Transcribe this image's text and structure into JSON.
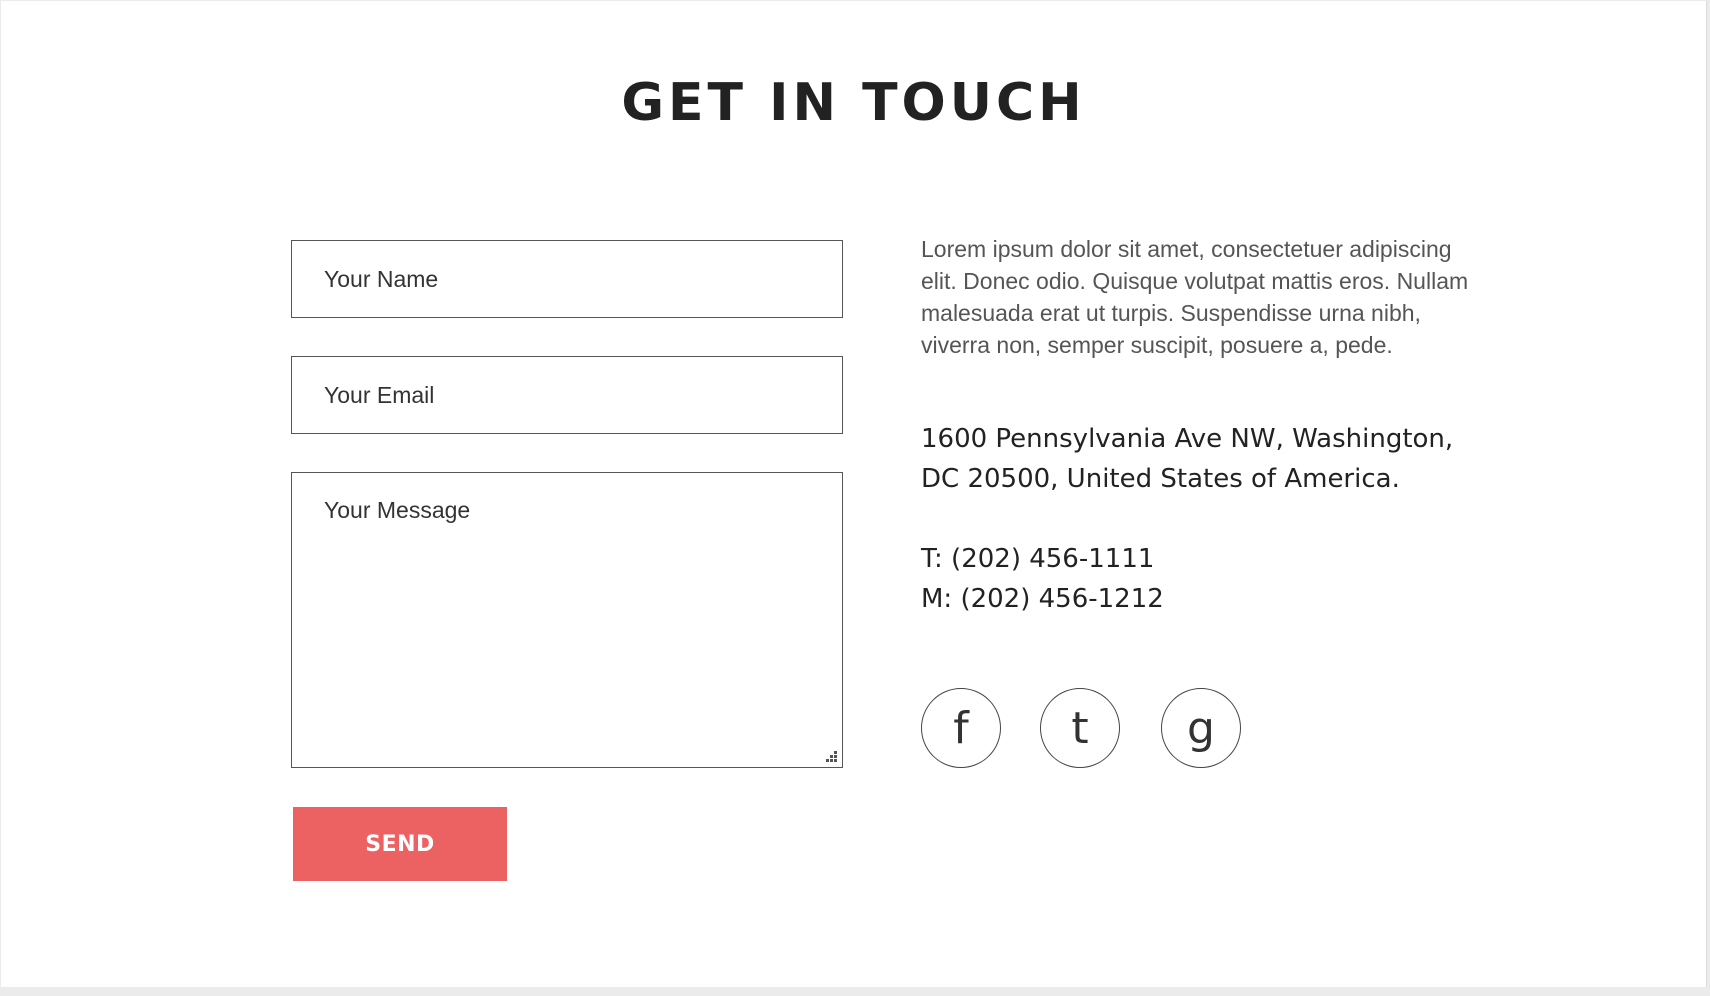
{
  "page": {
    "title": "GET IN TOUCH"
  },
  "form": {
    "name_placeholder": "Your Name",
    "email_placeholder": "Your Email",
    "message_placeholder": "Your Message",
    "send_label": "SEND"
  },
  "info": {
    "description": "Lorem ipsum dolor sit amet, consectetuer adipiscing elit. Donec odio. Quisque volutpat mattis eros. Nullam malesuada erat ut turpis. Suspendisse urna nibh, viverra non, semper suscipit, posuere a, pede.",
    "address_line1": "1600 Pennsylvania Ave NW, Washington,",
    "address_line2": "DC 20500, United States of America.",
    "phone": "T: (202) 456-1111",
    "mobile": "M: (202) 456-1212"
  },
  "social": [
    {
      "name": "facebook",
      "glyph": "f",
      "icon": "facebook-icon"
    },
    {
      "name": "twitter",
      "glyph": "t",
      "icon": "twitter-icon"
    },
    {
      "name": "google",
      "glyph": "g",
      "icon": "google-icon"
    }
  ],
  "colors": {
    "accent": "#ec6162",
    "background": "#ffffff",
    "text": "#222222",
    "muted_text": "#555555"
  }
}
